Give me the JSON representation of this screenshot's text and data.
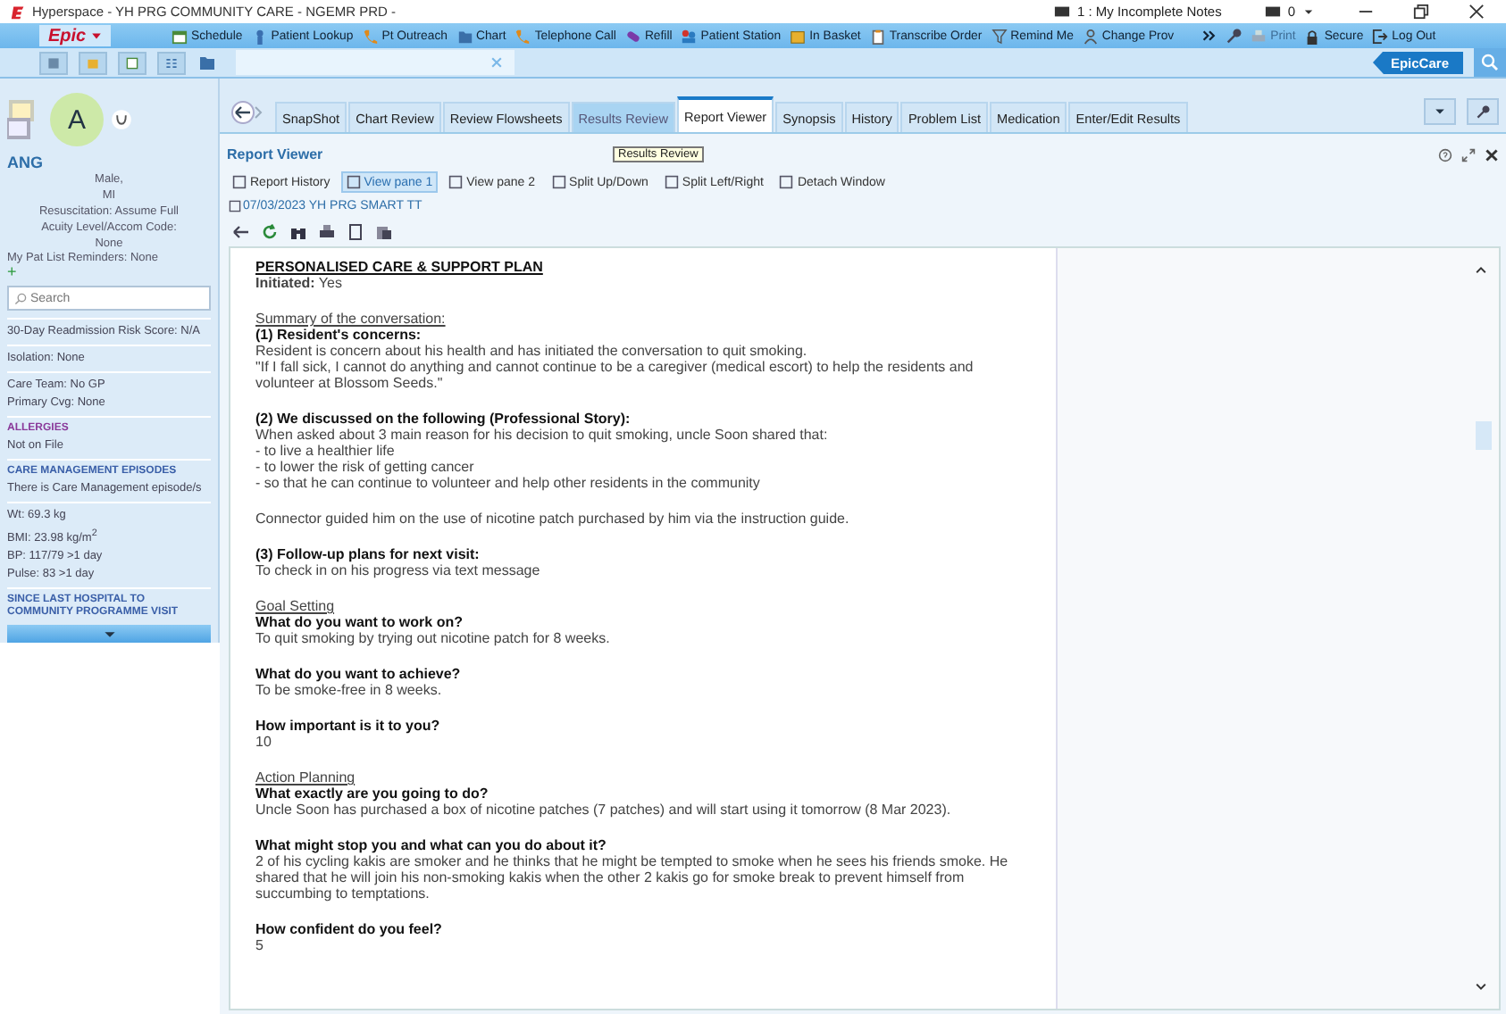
{
  "window": {
    "title": "Hyperspace - YH PRG COMMUNITY CARE - NGEMR PRD -",
    "notes": "1 : My Incomplete Notes",
    "messages": "0"
  },
  "menu_bar": {
    "brand": "Epic",
    "items": [
      {
        "label": "Schedule",
        "disabled": false
      },
      {
        "label": "Patient Lookup",
        "disabled": false
      },
      {
        "label": "Pt Outreach",
        "disabled": false
      },
      {
        "label": "Chart",
        "disabled": false
      },
      {
        "label": "Telephone Call",
        "disabled": false
      },
      {
        "label": "Refill",
        "disabled": false
      },
      {
        "label": "Patient Station",
        "disabled": false
      },
      {
        "label": "In Basket",
        "disabled": false
      },
      {
        "label": "Transcribe Order",
        "disabled": false
      },
      {
        "label": "Remind Me",
        "disabled": false
      },
      {
        "label": "Change Prov",
        "disabled": false
      }
    ],
    "right_items": [
      {
        "label": "Print",
        "disabled": true
      },
      {
        "label": "Secure",
        "disabled": false
      },
      {
        "label": "Log Out",
        "disabled": false
      }
    ]
  },
  "workspace_bar": {
    "badge": "EpicCare"
  },
  "sidebar": {
    "avatar": "A",
    "name": "ANG",
    "summary": [
      "Male,",
      "MI",
      "Resuscitation: Assume Full",
      "Acuity Level/Accom Code:",
      "None"
    ],
    "reminders": "My Pat List Reminders: None",
    "add": "+",
    "search": {
      "placeholder": "Search"
    },
    "sections": [
      {
        "lines": [
          "30-Day Readmission Risk Score: N/A"
        ]
      },
      {
        "lines": [
          "Isolation: None"
        ]
      },
      {
        "lines": [
          "Care Team: No GP",
          "Primary Cvg: None"
        ]
      },
      {
        "heading": "ALLERGIES",
        "color": "#8a3a9a",
        "lines": [
          "Not on File"
        ]
      },
      {
        "heading": "CARE MANAGEMENT EPISODES",
        "color": "#3a5fa8",
        "lines": [
          "There is Care Management episode/s"
        ]
      },
      {
        "lines": [
          "Wt:  69.3 kg",
          "BMI:  23.98 kg/m$^{2}$",
          "BP:  117/79 >1 day",
          "Pulse:  83 >1 day"
        ]
      },
      {
        "heading": "SINCE LAST HOSPITAL TO COMMUNITY PROGRAMME VISIT",
        "color": "#3a5fa8"
      }
    ]
  },
  "tabs": [
    {
      "label": "SnapShot",
      "selected": false,
      "hovered": false
    },
    {
      "label": "Chart Review",
      "selected": false,
      "hovered": false
    },
    {
      "label": "Review Flowsheets",
      "selected": false,
      "hovered": false
    },
    {
      "label": "Results Review",
      "selected": false,
      "hovered": true
    },
    {
      "label": "Report Viewer",
      "selected": true,
      "hovered": false
    },
    {
      "label": "Synopsis",
      "selected": false,
      "hovered": false
    },
    {
      "label": "History",
      "selected": false,
      "hovered": false
    },
    {
      "label": "Problem List",
      "selected": false,
      "hovered": false
    },
    {
      "label": "Medication",
      "selected": false,
      "hovered": false
    },
    {
      "label": "Enter/Edit Results",
      "selected": false,
      "hovered": false
    }
  ],
  "report_viewer": {
    "title": "Report Viewer",
    "tooltip": "Results Review",
    "toolbar": [
      {
        "label": "Report History",
        "selected": false
      },
      {
        "label": "View pane 1",
        "selected": true
      },
      {
        "label": "View pane 2",
        "selected": false
      },
      {
        "label": "Split Up/Down",
        "selected": false
      },
      {
        "label": "Split Left/Right",
        "selected": false
      },
      {
        "label": "Detach Window",
        "selected": false
      }
    ],
    "report_tab": "07/03/2023 YH PRG SMART TT",
    "document": [
      [
        {
          "kind": "title",
          "text": "PERSONALISED CARE & SUPPORT PLAN"
        },
        {
          "kind": "text",
          "text": "**Initiated:** Yes"
        }
      ],
      [
        {
          "kind": "section",
          "text": "Summary of the conversation:"
        },
        {
          "kind": "question",
          "text": "(1) Resident's concerns:"
        },
        {
          "kind": "text",
          "text": "Resident is concern about his health and has initiated the conversation to quit smoking."
        },
        {
          "kind": "text",
          "text": "\"If I fall sick, I cannot do anything and cannot continue to be a caregiver (medical escort) to help the residents and volunteer at Blossom Seeds.\""
        }
      ],
      [
        {
          "kind": "question",
          "text": "(2) We discussed on the following (Professional Story):"
        },
        {
          "kind": "text",
          "text": "When asked about 3 main reason for his decision to quit smoking, uncle Soon shared that:"
        },
        {
          "kind": "text",
          "text": "- to live a healthier life"
        },
        {
          "kind": "text",
          "text": "- to lower the risk of getting cancer"
        },
        {
          "kind": "text",
          "text": "- so that he can continue to volunteer and help other residents in the community"
        }
      ],
      [
        {
          "kind": "text",
          "text": "Connector guided him on the use of nicotine patch purchased by him via the instruction guide."
        }
      ],
      [
        {
          "kind": "question",
          "text": "(3) Follow-up plans for next visit:"
        },
        {
          "kind": "text",
          "text": "To check in on his progress via text message"
        }
      ],
      [
        {
          "kind": "section",
          "text": "Goal Setting"
        },
        {
          "kind": "question",
          "text": "What do you want to work on?"
        },
        {
          "kind": "text",
          "text": "To quit smoking by trying out nicotine patch for 8 weeks."
        }
      ],
      [
        {
          "kind": "question",
          "text": "What do you want to achieve?"
        },
        {
          "kind": "text",
          "text": "To be smoke-free in 8 weeks."
        }
      ],
      [
        {
          "kind": "question",
          "text": "How important is it to you?"
        },
        {
          "kind": "text",
          "text": "10"
        }
      ],
      [
        {
          "kind": "section",
          "text": "Action Planning"
        },
        {
          "kind": "question",
          "text": "What exactly are you going to do?"
        },
        {
          "kind": "text",
          "text": "Uncle Soon has purchased a box of nicotine patches (7 patches) and will start using it tomorrow (8 Mar 2023)."
        }
      ],
      [
        {
          "kind": "question",
          "text": "What might stop you and what can you do about it?"
        },
        {
          "kind": "text",
          "text": "2 of his cycling kakis are smoker and he thinks that he might be tempted to smoke when he sees his friends smoke. He shared that he will join his non-smoking kakis when the other 2 kakis go for smoke break to prevent himself from succumbing to temptations."
        }
      ],
      [
        {
          "kind": "question",
          "text": "How confident do you feel?"
        },
        {
          "kind": "text",
          "text": "5"
        }
      ]
    ]
  }
}
